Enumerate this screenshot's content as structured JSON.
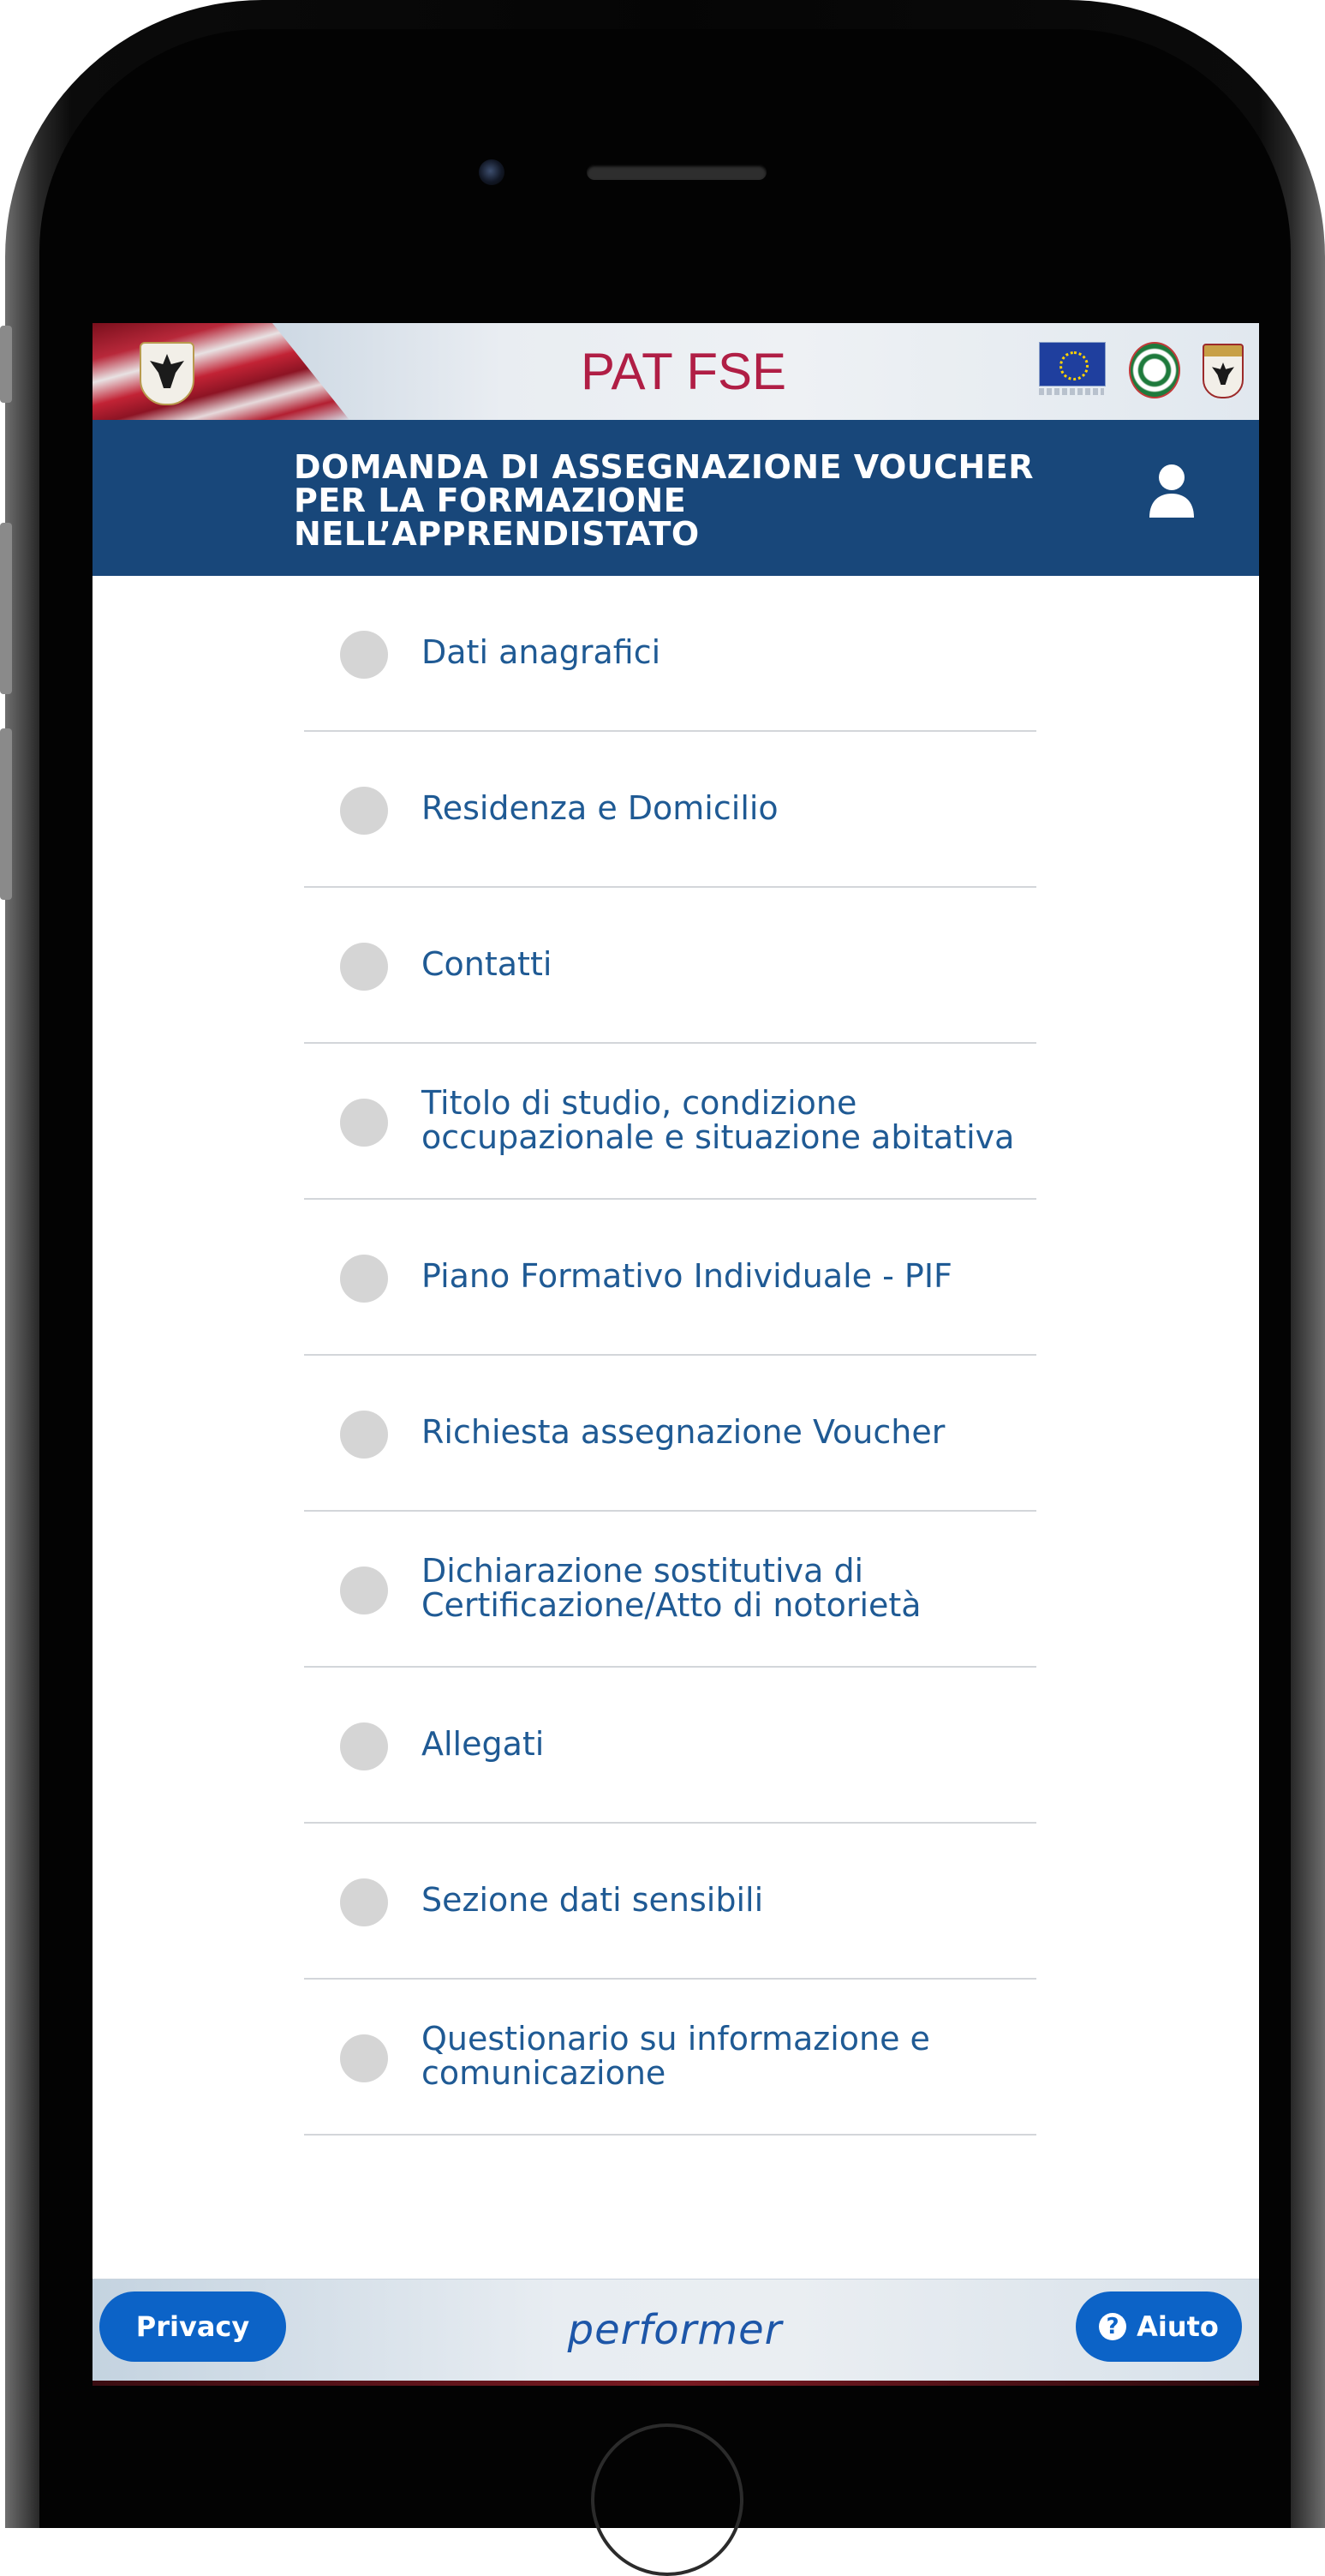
{
  "header": {
    "app_title": "PAT FSE"
  },
  "title_bar": {
    "form_title": "DOMANDA DI ASSEGNAZIONE VOUCHER\nPER LA FORMAZIONE\nNELL’APPRENDISTATO"
  },
  "menu": {
    "items": [
      {
        "label": "Dati anagrafici"
      },
      {
        "label": "Residenza e Domicilio"
      },
      {
        "label": "Contatti"
      },
      {
        "label": "Titolo di studio, condizione\noccupazionale e situazione abitativa"
      },
      {
        "label": "Piano Formativo Individuale - PIF"
      },
      {
        "label": "Richiesta assegnazione Voucher"
      },
      {
        "label": "Dichiarazione sostitutiva di\nCertificazione/Atto di notorietà"
      },
      {
        "label": "Allegati"
      },
      {
        "label": "Sezione dati sensibili"
      },
      {
        "label": "Questionario su informazione e\ncomunicazione"
      }
    ]
  },
  "footer": {
    "privacy_label": "Privacy",
    "brand": "performer",
    "help_label": "Aiuto"
  },
  "icons": {
    "user": "user-icon",
    "help": "question-circle-icon",
    "status_dot": "status-dot-icon"
  },
  "colors": {
    "title_bar": "#18477a",
    "app_title": "#b01e45",
    "menu_label": "#1f5a94",
    "button": "#0c63c7",
    "status_dot": "#d5d5d5"
  }
}
